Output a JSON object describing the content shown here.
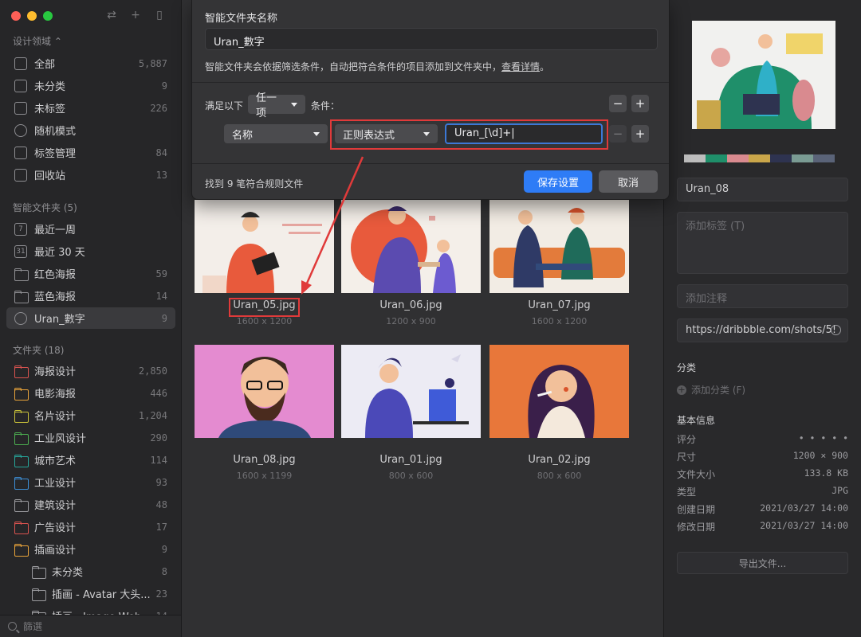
{
  "sidebar": {
    "library": "设计领域 ⌃",
    "nav": [
      {
        "label": "全部",
        "count": "5,887",
        "icon": "grid-icon"
      },
      {
        "label": "未分类",
        "count": "9",
        "icon": "question-icon"
      },
      {
        "label": "未标签",
        "count": "226",
        "icon": "tag-off-icon"
      },
      {
        "label": "随机模式",
        "count": "",
        "icon": "bulb-icon"
      },
      {
        "label": "标签管理",
        "count": "84",
        "icon": "tag-icon"
      },
      {
        "label": "回收站",
        "count": "13",
        "icon": "trash-icon"
      }
    ],
    "smart_title": "智能文件夹 (5)",
    "smart": [
      {
        "label": "最近一周",
        "count": "",
        "icon": "calendar-7-icon",
        "glyph": "7"
      },
      {
        "label": "最近 30 天",
        "count": "",
        "icon": "calendar-31-icon",
        "glyph": "31"
      },
      {
        "label": "红色海报",
        "count": "59",
        "icon": "smart-folder-icon"
      },
      {
        "label": "蓝色海报",
        "count": "14",
        "icon": "smart-folder-icon"
      },
      {
        "label": "Uran_數字",
        "count": "9",
        "icon": "gear-icon"
      }
    ],
    "folders_title": "文件夹 (18)",
    "folders": [
      {
        "label": "海报设计",
        "count": "2,850",
        "color": "#d9534f"
      },
      {
        "label": "电影海报",
        "count": "446",
        "color": "#e8a33a"
      },
      {
        "label": "名片设计",
        "count": "1,204",
        "color": "#c9c23a"
      },
      {
        "label": "工业风设计",
        "count": "290",
        "color": "#4caf50"
      },
      {
        "label": "城市艺术",
        "count": "114",
        "color": "#26a69a"
      },
      {
        "label": "工业设计",
        "count": "93",
        "color": "#3d8fd6"
      },
      {
        "label": "建筑设计",
        "count": "48",
        "color": "#9a9a9e"
      },
      {
        "label": "广告设计",
        "count": "17",
        "color": "#d9534f"
      },
      {
        "label": "插画设计",
        "count": "9",
        "color": "#e8a33a"
      },
      {
        "label": "未分类",
        "count": "8",
        "color": "#9a9a9e"
      },
      {
        "label": "插画 - Avatar 大头...",
        "count": "23",
        "color": "#9a9a9e"
      },
      {
        "label": "插画 - Image Web...",
        "count": "14",
        "color": "#9a9a9e"
      }
    ],
    "filter_placeholder": "篩選"
  },
  "modal": {
    "name_label": "智能文件夹名称",
    "name_value": "Uran_數字",
    "desc": "智能文件夹会依据筛选条件，自动把符合条件的项目添加到文件夹中，",
    "desc_link": "查看详情",
    "desc_end": "。",
    "match_prefix": "满足以下",
    "match_mode": "任一项",
    "match_suffix": "条件：",
    "rule_field": "名称",
    "rule_operator": "正则表达式",
    "rule_value": "Uran_[\\d]+|",
    "found_text": "找到 9 笔符合规则文件",
    "save_label": "保存设置",
    "cancel_label": "取消",
    "minus": "−",
    "plus": "+"
  },
  "grid": [
    {
      "name": "Uran_05.jpg",
      "size": "1600 x 1200"
    },
    {
      "name": "Uran_06.jpg",
      "size": "1200 x 900"
    },
    {
      "name": "Uran_07.jpg",
      "size": "1600 x 1200"
    },
    {
      "name": "Uran_08.jpg",
      "size": "1600 x 1199"
    },
    {
      "name": "Uran_01.jpg",
      "size": "800 x 600"
    },
    {
      "name": "Uran_02.jpg",
      "size": "800 x 600"
    }
  ],
  "inspector": {
    "swatches": [
      "#bdbdbd",
      "#1f8f6a",
      "#d98a8f",
      "#c9a64a",
      "#2e3350",
      "#7a9b93",
      "#5a6378"
    ],
    "name": "Uran_08",
    "tags_placeholder": "添加标签 (T)",
    "note_placeholder": "添加注释",
    "url": "https://dribbble.com/shots/5!",
    "category_title": "分类",
    "add_category": "添加分类 (F)",
    "info_title": "基本信息",
    "info": [
      {
        "k": "评分",
        "v": "• • • • •"
      },
      {
        "k": "尺寸",
        "v": "1200 × 900"
      },
      {
        "k": "文件大小",
        "v": "133.8 KB"
      },
      {
        "k": "类型",
        "v": "JPG"
      },
      {
        "k": "创建日期",
        "v": "2021/03/27 14:00"
      },
      {
        "k": "修改日期",
        "v": "2021/03/27 14:00"
      }
    ],
    "export_label": "导出文件..."
  }
}
